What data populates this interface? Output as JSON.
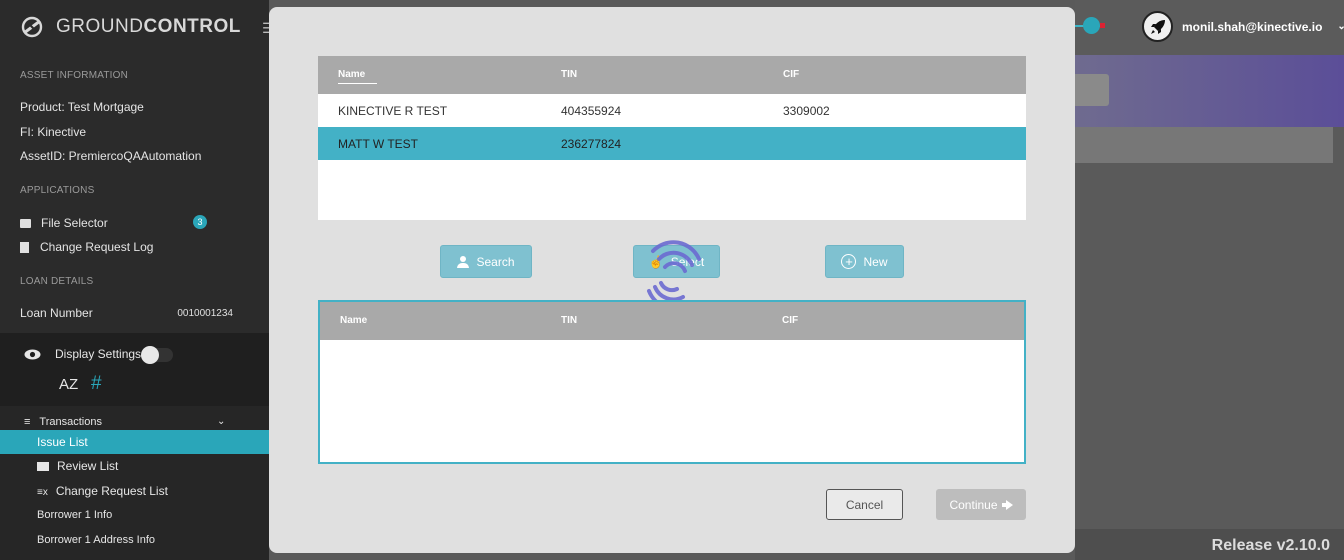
{
  "sidebar": {
    "brand_light": "GROUND",
    "brand_bold": "CONTROL",
    "asset_info_heading": "ASSET INFORMATION",
    "product": "Product:  Test Mortgage",
    "fi": "FI:  Kinective",
    "asset_id": "AssetID:  PremiercoQAAutomation",
    "applications_heading": "APPLICATIONS",
    "file_selector": "File Selector",
    "file_selector_badge": "3",
    "change_request_log": "Change Request Log",
    "loan_details_heading": "LOAN DETAILS",
    "loan_number_label": "Loan Number",
    "loan_number_value": "0010001234",
    "display_settings": "Display Settings",
    "sort_glyph": "AZ",
    "hash_glyph": "#",
    "transactions": "Transactions",
    "nav_items": [
      "Issue List",
      "Review List",
      "Change Request List",
      "Borrower 1 Info",
      "Borrower 1 Address Info"
    ]
  },
  "header": {
    "user_email": "monil.shah@kinective.io"
  },
  "footer": {
    "release": "Release v2.10.0"
  },
  "modal": {
    "results_table": {
      "columns": [
        "Name",
        "TIN",
        "CIF"
      ],
      "rows": [
        {
          "name": "KINECTIVE R TEST",
          "tin": "404355924",
          "cif": "3309002"
        },
        {
          "name": "MATT W TEST",
          "tin": "236277824",
          "cif": ""
        }
      ]
    },
    "buttons": {
      "search": "Search",
      "select": "Select",
      "new": "New",
      "cancel": "Cancel",
      "continue": "Continue"
    },
    "selected_table": {
      "columns": [
        "Name",
        "TIN",
        "CIF"
      ]
    }
  },
  "colors": {
    "accent": "#2aa6b9",
    "selected_row": "#43b1c6",
    "spinner": "#6b6ad0"
  }
}
